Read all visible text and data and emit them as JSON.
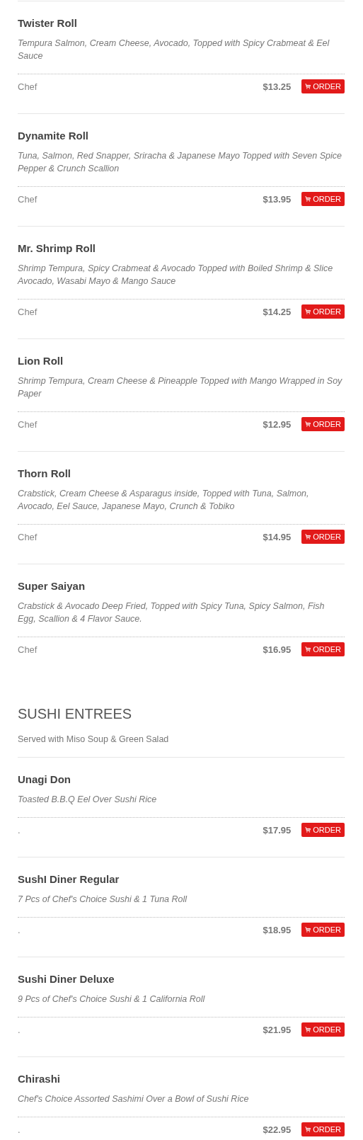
{
  "sections": [
    {
      "items": [
        {
          "name": "Twister Roll",
          "description": "Tempura Salmon, Cream Cheese, Avocado, Topped with Spicy Crabmeat & Eel Sauce",
          "tag": "Chef",
          "price": "$13.25",
          "button": "ORDER"
        },
        {
          "name": "Dynamite Roll",
          "description": "Tuna, Salmon, Red Snapper, Sriracha & Japanese Mayo Topped with Seven Spice Pepper & Crunch Scallion",
          "tag": "Chef",
          "price": "$13.95",
          "button": "ORDER"
        },
        {
          "name": "Mr. Shrimp Roll",
          "description": "Shrimp Tempura, Spicy Crabmeat & Avocado Topped with Boiled Shrimp & Slice Avocado, Wasabi Mayo & Mango Sauce",
          "tag": "Chef",
          "price": "$14.25",
          "button": "ORDER"
        },
        {
          "name": "Lion Roll",
          "description": "Shrimp Tempura, Cream Cheese & Pineapple Topped with Mango Wrapped in Soy Paper",
          "tag": "Chef",
          "price": "$12.95",
          "button": "ORDER"
        },
        {
          "name": "Thorn Roll",
          "description": "Crabstick, Cream Cheese & Asparagus inside, Topped with Tuna, Salmon, Avocado, Eel Sauce, Japanese Mayo, Crunch & Tobiko",
          "tag": "Chef",
          "price": "$14.95",
          "button": "ORDER"
        },
        {
          "name": "Super Saiyan",
          "description": "Crabstick & Avocado Deep Fried, Topped with Spicy Tuna, Spicy Salmon, Fish Egg, Scallion & 4 Flavor Sauce.",
          "tag": "Chef",
          "price": "$16.95",
          "button": "ORDER"
        }
      ]
    },
    {
      "title": "SUSHI ENTREES",
      "subtitle": "Served with Miso Soup & Green Salad",
      "items": [
        {
          "name": "Unagi Don",
          "description": "Toasted B.B.Q Eel Over Sushi Rice",
          "tag": ".",
          "price": "$17.95",
          "button": "ORDER"
        },
        {
          "name": "SushI Diner Regular",
          "description": "7 Pcs of Chef's Choice Sushi & 1 Tuna Roll",
          "tag": ".",
          "price": "$18.95",
          "button": "ORDER"
        },
        {
          "name": "Sushi Diner Deluxe",
          "description": "9 Pcs of Chef's Choice Sushi & 1 California Roll",
          "tag": ".",
          "price": "$21.95",
          "button": "ORDER"
        },
        {
          "name": "Chirashi",
          "description": "Chef's Choice Assorted Sashimi Over a Bowl of Sushi Rice",
          "tag": ".",
          "price": "$22.95",
          "button": "ORDER"
        }
      ]
    }
  ]
}
